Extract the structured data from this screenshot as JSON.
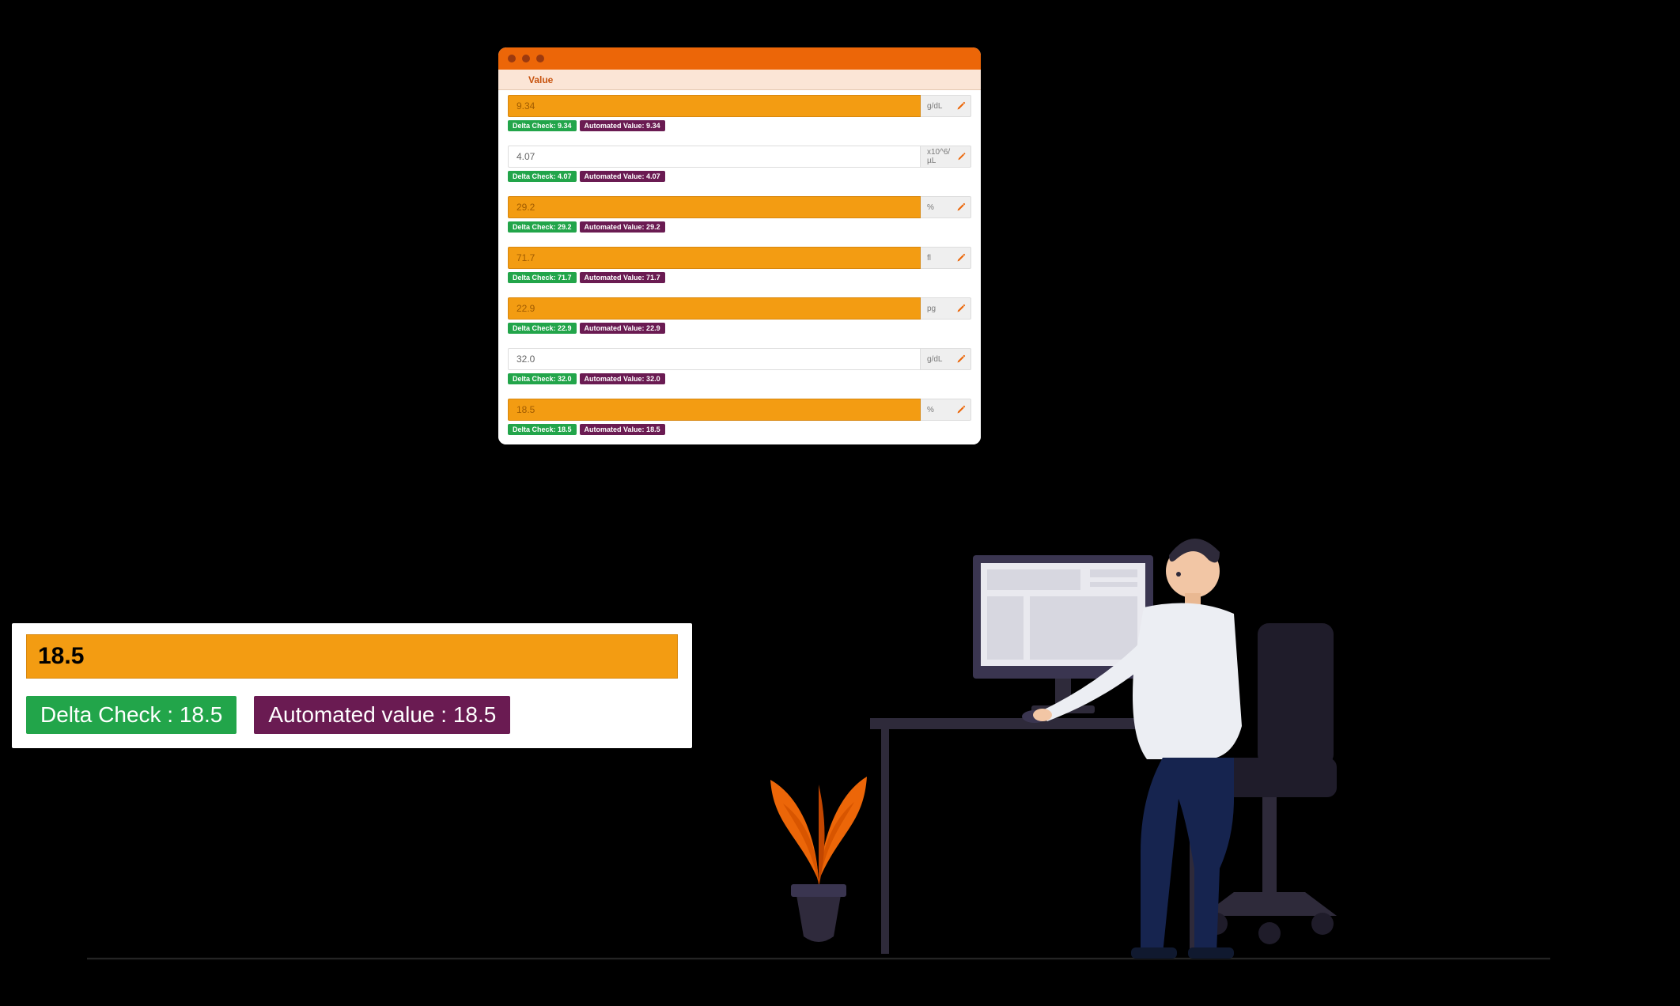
{
  "header": {
    "column_label": "Value"
  },
  "rows": [
    {
      "value": "9.34",
      "unit": "g/dL",
      "highlight": true,
      "delta": "9.34",
      "auto": "9.34"
    },
    {
      "value": "4.07",
      "unit": "x10^6/µL",
      "highlight": false,
      "delta": "4.07",
      "auto": "4.07"
    },
    {
      "value": "29.2",
      "unit": "%",
      "highlight": true,
      "delta": "29.2",
      "auto": "29.2"
    },
    {
      "value": "71.7",
      "unit": "fl",
      "highlight": true,
      "delta": "71.7",
      "auto": "71.7"
    },
    {
      "value": "22.9",
      "unit": "pg",
      "highlight": true,
      "delta": "22.9",
      "auto": "22.9"
    },
    {
      "value": "32.0",
      "unit": "g/dL",
      "highlight": false,
      "delta": "32.0",
      "auto": "32.0"
    },
    {
      "value": "18.5",
      "unit": "%",
      "highlight": true,
      "delta": "18.5",
      "auto": "18.5"
    }
  ],
  "labels": {
    "delta_prefix_small": "Delta Check: ",
    "auto_prefix_small": "Automated Value: ",
    "delta_prefix_big": "Delta Check : ",
    "auto_prefix_big": "Automated value : "
  },
  "callout": {
    "value": "18.5",
    "delta": "18.5",
    "auto": "18.5"
  }
}
